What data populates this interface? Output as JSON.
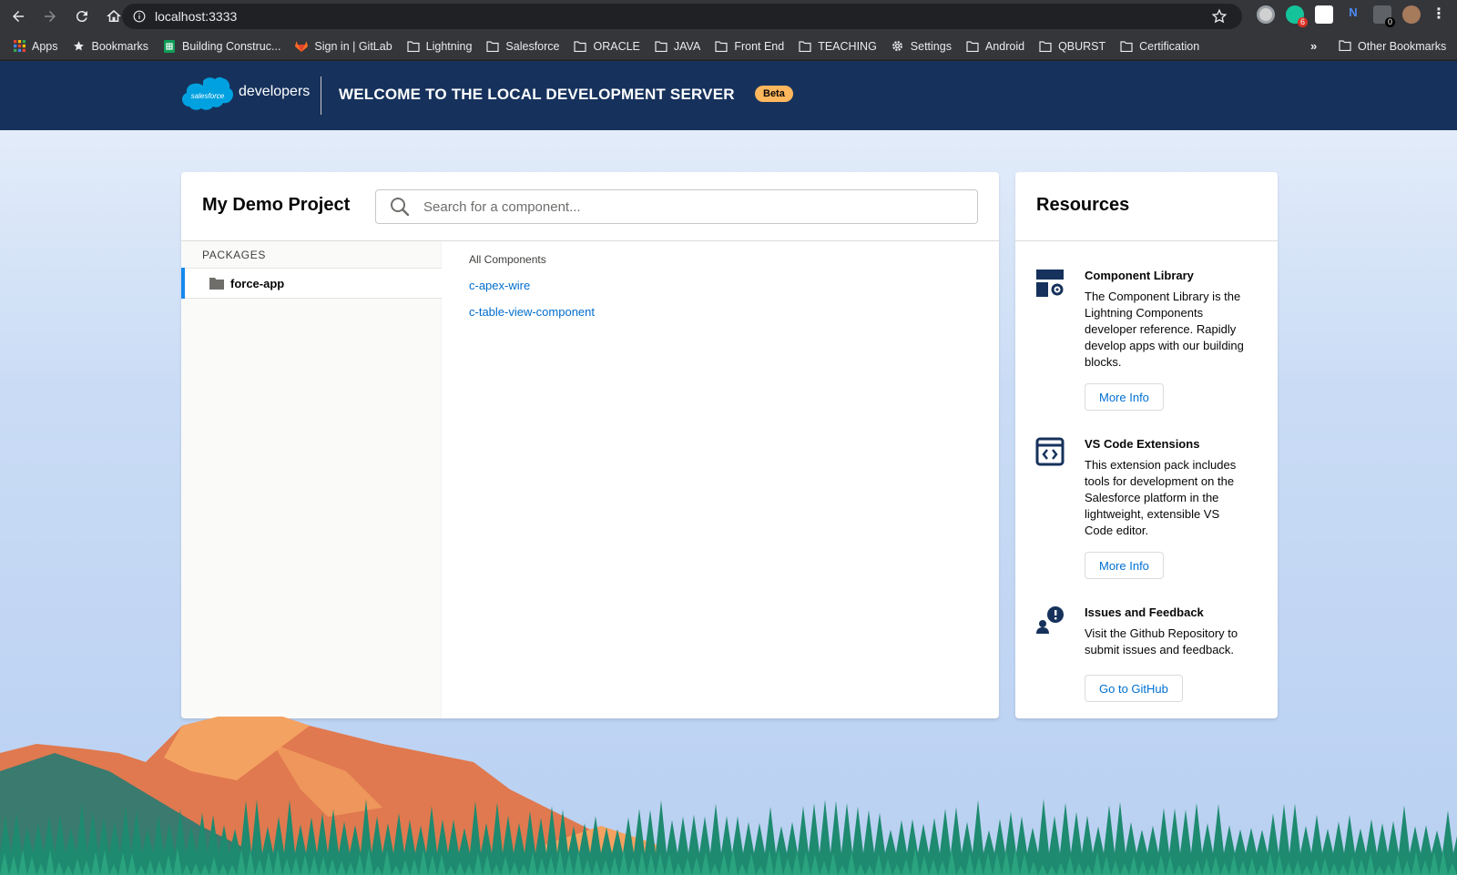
{
  "browser": {
    "url": "localhost:3333",
    "bookmarks": [
      {
        "label": "Apps",
        "icon": "apps-grid-icon"
      },
      {
        "label": "Bookmarks",
        "icon": "star-icon"
      },
      {
        "label": "Building Construc...",
        "icon": "sheets-icon"
      },
      {
        "label": "Sign in | GitLab",
        "icon": "gitlab-icon"
      },
      {
        "label": "Lightning",
        "icon": "folder-icon"
      },
      {
        "label": "Salesforce",
        "icon": "folder-icon"
      },
      {
        "label": "ORACLE",
        "icon": "folder-icon"
      },
      {
        "label": "JAVA",
        "icon": "folder-icon"
      },
      {
        "label": "Front End",
        "icon": "folder-icon"
      },
      {
        "label": "TEACHING",
        "icon": "folder-icon"
      },
      {
        "label": "Settings",
        "icon": "gear-icon"
      },
      {
        "label": "Android",
        "icon": "folder-icon"
      },
      {
        "label": "QBURST",
        "icon": "folder-icon"
      },
      {
        "label": "Certification",
        "icon": "folder-icon"
      }
    ],
    "more_label": "»",
    "other_bookmarks": "Other Bookmarks",
    "extension_badges": {
      "grammarly": "6",
      "ext": "0"
    }
  },
  "header": {
    "logo_text": "salesforce",
    "brand": "developers",
    "title": "WELCOME TO THE LOCAL DEVELOPMENT SERVER",
    "badge": "Beta"
  },
  "project": {
    "title": "My Demo Project",
    "search_placeholder": "Search for a component...",
    "packages_label": "PACKAGES",
    "packages": [
      {
        "label": "force-app"
      }
    ],
    "components_label": "All Components",
    "components": [
      "c-apex-wire",
      "c-table-view-component"
    ]
  },
  "resources": {
    "title": "Resources",
    "items": [
      {
        "title": "Component Library",
        "description": "The Component Library is the Lightning Components developer reference. Rapidly develop apps with our building blocks.",
        "button": "More Info",
        "icon": "component-library-icon"
      },
      {
        "title": "VS Code Extensions",
        "description": "This extension pack includes tools for development on the Salesforce platform in the lightweight, extensible VS Code editor.",
        "button": "More Info",
        "icon": "code-window-icon"
      },
      {
        "title": "Issues and Feedback",
        "description": "Visit the Github Repository to submit issues and feedback.",
        "button": "Go to GitHub",
        "icon": "feedback-icon"
      }
    ]
  },
  "colors": {
    "header_bg": "#16325c",
    "link": "#006dcc",
    "badge": "#ffb75d",
    "active_bar": "#1589ee"
  }
}
